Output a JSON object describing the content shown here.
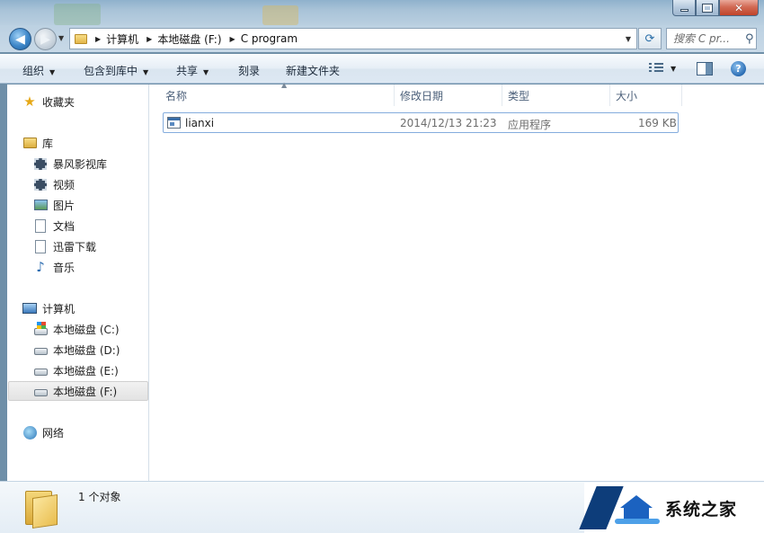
{
  "window": {
    "minimize_symbol": "",
    "maximize_symbol": "",
    "close_symbol": "✕"
  },
  "nav": {
    "back_symbol": "◀",
    "forward_symbol": "▶",
    "breadcrumb": [
      "计算机",
      "本地磁盘 (F:)",
      "C program"
    ],
    "refresh_symbol": "⟳",
    "search_placeholder": "搜索 C pr...",
    "search_symbol": "⚲"
  },
  "toolbar": {
    "organize": "组织",
    "include_in_library": "包含到库中",
    "share": "共享",
    "burn": "刻录",
    "new_folder": "新建文件夹",
    "help_symbol": "?"
  },
  "sidebar": {
    "favorites": "收藏夹",
    "libraries": "库",
    "library_items": [
      "暴风影视库",
      "视频",
      "图片",
      "文档",
      "迅雷下载",
      "音乐"
    ],
    "computer": "计算机",
    "drives": [
      "本地磁盘 (C:)",
      "本地磁盘 (D:)",
      "本地磁盘 (E:)",
      "本地磁盘 (F:)"
    ],
    "selected_drive": "本地磁盘 (F:)",
    "network": "网络"
  },
  "columns": {
    "name": "名称",
    "modified": "修改日期",
    "type": "类型",
    "size": "大小"
  },
  "files": [
    {
      "name": "lianxi",
      "modified": "2014/12/13 21:23",
      "type": "应用程序",
      "size": "169 KB"
    }
  ],
  "details": {
    "count_text": "1 个对象"
  },
  "watermark": {
    "text": "系统之家"
  },
  "colors": {
    "toolbar_bg": "#dde8f3",
    "selection_border": "#84acdd",
    "accent_blue": "#2b6db4"
  }
}
